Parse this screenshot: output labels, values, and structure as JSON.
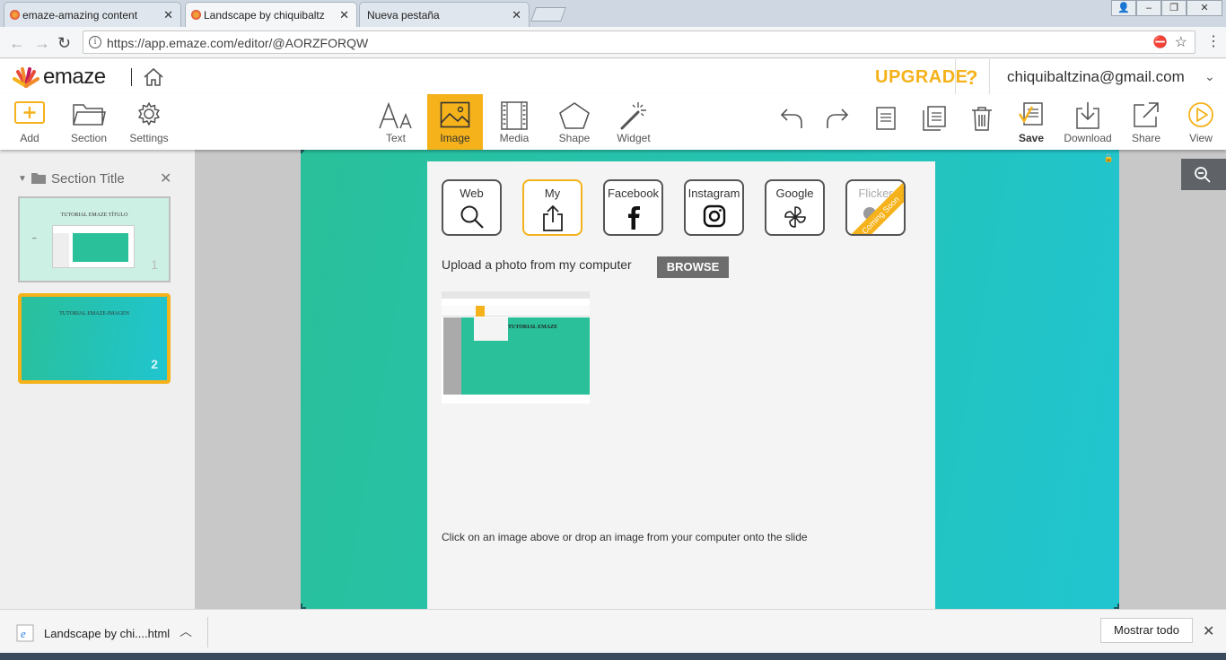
{
  "browser": {
    "tabs": [
      {
        "title": "emaze-amazing content"
      },
      {
        "title": "Landscape by chiquibaltz"
      },
      {
        "title": "Nueva pestaña"
      }
    ],
    "url": "https://app.emaze.com/editor/@AORZFORQW"
  },
  "header": {
    "logo": "emaze",
    "upgrade": "UPGRADE",
    "help": "?",
    "email": "chiquibaltzina@gmail.com"
  },
  "toolbar": {
    "left": [
      {
        "label": "Add",
        "icon": "add-icon"
      },
      {
        "label": "Section",
        "icon": "folder-icon"
      },
      {
        "label": "Settings",
        "icon": "gear-icon"
      }
    ],
    "center": [
      {
        "label": "Text",
        "icon": "text-icon"
      },
      {
        "label": "Image",
        "icon": "image-icon",
        "selected": true
      },
      {
        "label": "Media",
        "icon": "film-icon"
      },
      {
        "label": "Shape",
        "icon": "pentagon-icon"
      },
      {
        "label": "Widget",
        "icon": "magic-wand-icon"
      }
    ],
    "right": [
      {
        "label": "Save",
        "icon": "save-icon"
      },
      {
        "label": "Download",
        "icon": "download-icon"
      },
      {
        "label": "Share",
        "icon": "share-icon"
      },
      {
        "label": "View",
        "icon": "play-icon"
      }
    ]
  },
  "sidebar": {
    "section_title": "Section Title",
    "slides": [
      {
        "number": "1",
        "title": "TUTORIAL EMAZE TÍTULO"
      },
      {
        "number": "2",
        "title": "TUTORIAL EMAZE-IMAGEN",
        "selected": true
      }
    ]
  },
  "image_panel": {
    "sources": [
      {
        "label": "Web",
        "icon": "search-icon"
      },
      {
        "label": "My",
        "icon": "upload-icon",
        "selected": true
      },
      {
        "label": "Facebook",
        "icon": "facebook-icon"
      },
      {
        "label": "Instagram",
        "icon": "instagram-icon"
      },
      {
        "label": "Google",
        "icon": "google-icon"
      },
      {
        "label": "Flicker",
        "icon": "flickr-icon",
        "badge": "Coming Soon"
      }
    ],
    "upload_text": "Upload a photo from my computer",
    "browse": "BROWSE",
    "thumbnail_title": "TUTORIAL EMAZE",
    "hint": "Click on an image above or drop an image from your computer onto the slide"
  },
  "download_bar": {
    "file": "Landscape by chi....html",
    "show_all": "Mostrar todo"
  },
  "colors": {
    "accent": "#f5b21b",
    "slide_start": "#29c09a",
    "slide_end": "#20c5d0"
  }
}
